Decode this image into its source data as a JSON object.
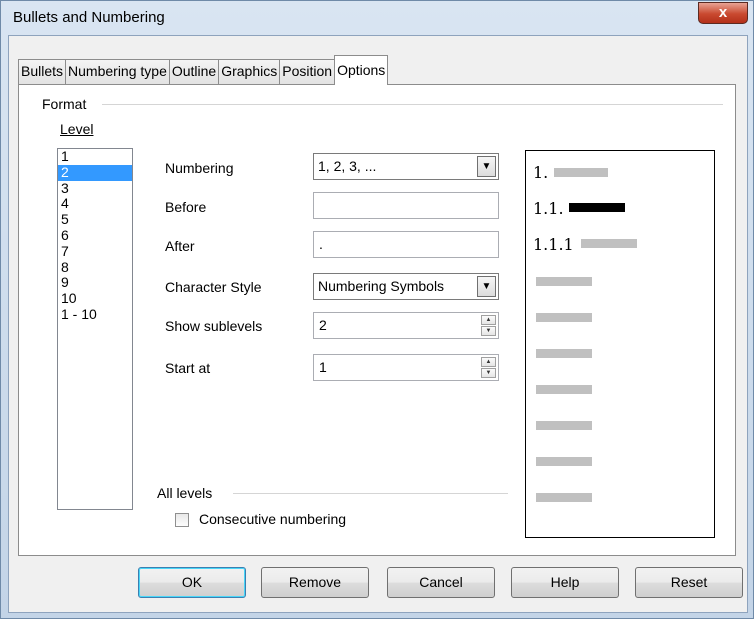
{
  "window": {
    "title": "Bullets and Numbering",
    "close_label": "x"
  },
  "tabs": [
    {
      "label": "Bullets",
      "active": false
    },
    {
      "label": "Numbering type",
      "active": false
    },
    {
      "label": "Outline",
      "active": false
    },
    {
      "label": "Graphics",
      "active": false
    },
    {
      "label": "Position",
      "active": false
    },
    {
      "label": "Options",
      "active": true
    }
  ],
  "format": {
    "group_label": "Format",
    "level_label": "Level",
    "levels": [
      "1",
      "2",
      "3",
      "4",
      "5",
      "6",
      "7",
      "8",
      "9",
      "10",
      "1 - 10"
    ],
    "selected_level": "2",
    "numbering_label": "Numbering",
    "numbering_value": "1, 2, 3, ...",
    "before_label": "Before",
    "before_value": "",
    "after_label": "After",
    "after_value": ".",
    "char_style_label": "Character Style",
    "char_style_value": "Numbering Symbols",
    "show_sublevels_label": "Show sublevels",
    "show_sublevels_value": "2",
    "start_at_label": "Start at",
    "start_at_value": "1"
  },
  "all_levels": {
    "group_label": "All levels",
    "consecutive_label": "Consecutive numbering",
    "consecutive_checked": false
  },
  "preview": {
    "rows": [
      "1.",
      "1.1.",
      "1.1.1"
    ],
    "highlight_row": "1.1."
  },
  "buttons": {
    "ok": "OK",
    "remove": "Remove",
    "cancel": "Cancel",
    "help": "Help",
    "reset": "Reset"
  }
}
